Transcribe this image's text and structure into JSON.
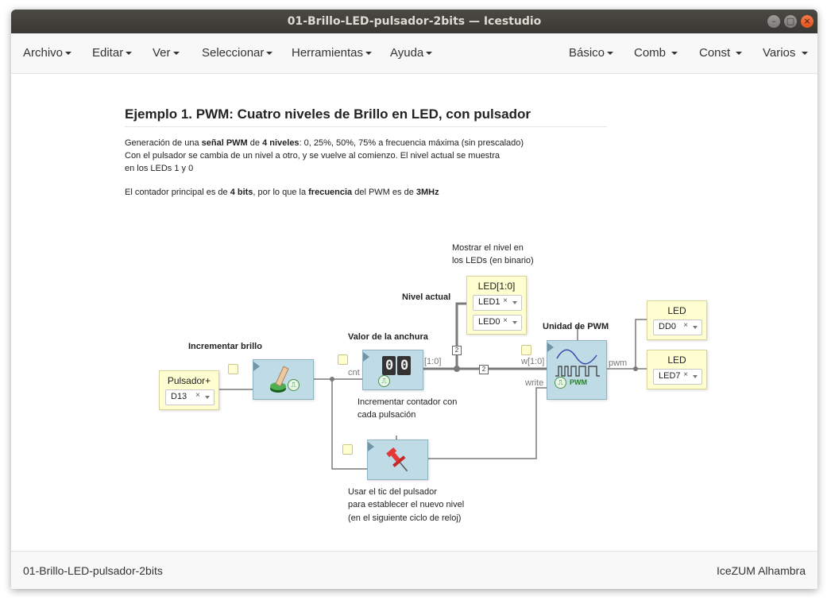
{
  "window": {
    "title": "01-Brillo-LED-pulsador-2bits — Icestudio"
  },
  "menu": {
    "left": [
      {
        "label": "Archivo"
      },
      {
        "label": "Editar"
      },
      {
        "label": "Ver"
      },
      {
        "label": "Seleccionar"
      },
      {
        "label": "Herramientas"
      },
      {
        "label": "Ayuda"
      }
    ],
    "right": [
      {
        "label": "Básico"
      },
      {
        "label": "Comb"
      },
      {
        "label": "Const"
      },
      {
        "label": "Varios"
      }
    ]
  },
  "doc": {
    "title": "Ejemplo 1. PWM: Cuatro niveles de Brillo en LED, con pulsador",
    "p1_a": "Generación de una ",
    "p1_b": "señal PWM",
    "p1_c": " de ",
    "p1_d": "4 niveles",
    "p1_e": ": 0, 25%, 50%, 75% a frecuencia máxima (sin prescalado)",
    "p1_line2": "Con el pulsador se cambia de un nivel a otro, y se vuelve al comienzo. El nivel actual se muestra",
    "p1_line3": "en los LEDs 1 y 0",
    "p2_a": "El contador principal es de ",
    "p2_b": "4 bits",
    "p2_c": ", por lo que la ",
    "p2_d": "frecuencia",
    "p2_e": " del PWM es de ",
    "p2_f": "3MHz"
  },
  "diagram": {
    "labels": {
      "show_level_1": "Mostrar el nivel en",
      "show_level_2": "los LEDs (en binario)",
      "nivel_actual": "Nivel actual",
      "valor_anchura": "Valor de la anchura",
      "unidad_pwm": "Unidad de PWM",
      "incrementar_brillo": "Incrementar brillo",
      "inc_contador_1": "Incrementar contador con",
      "inc_contador_2": "cada pulsación",
      "usar_tic_1": "Usar el tic del pulsador",
      "usar_tic_2": "para establecer el nuevo nivel",
      "usar_tic_3": "(en el siguiente ciclo de reloj)"
    },
    "ports": {
      "cnt": "cnt",
      "range": "[1:0]",
      "w": "w[1:0]",
      "write": "write",
      "pwm": "pwm",
      "pwm_block": "PWM",
      "bus_width_1": "2",
      "bus_width_2": "2"
    },
    "counter_digits": [
      "0",
      "0"
    ],
    "inputs": [
      {
        "name": "Pulsador+",
        "pin": "D13",
        "clear": "×"
      }
    ],
    "outputs": [
      {
        "name": "LED[1:0]",
        "pins": [
          "LED1",
          "LED0"
        ],
        "clear": "×"
      },
      {
        "name": "LED",
        "pins": [
          "DD0"
        ],
        "clear": "×"
      },
      {
        "name": "LED",
        "pins": [
          "LED7"
        ],
        "clear": "×"
      }
    ]
  },
  "footer": {
    "left": "01-Brillo-LED-pulsador-2bits",
    "right": "IceZUM Alhambra"
  },
  "colors": {
    "io_block": "#fffed0",
    "logic_block": "#bfdbe6",
    "wire": "#777777",
    "bus": "#777777"
  }
}
